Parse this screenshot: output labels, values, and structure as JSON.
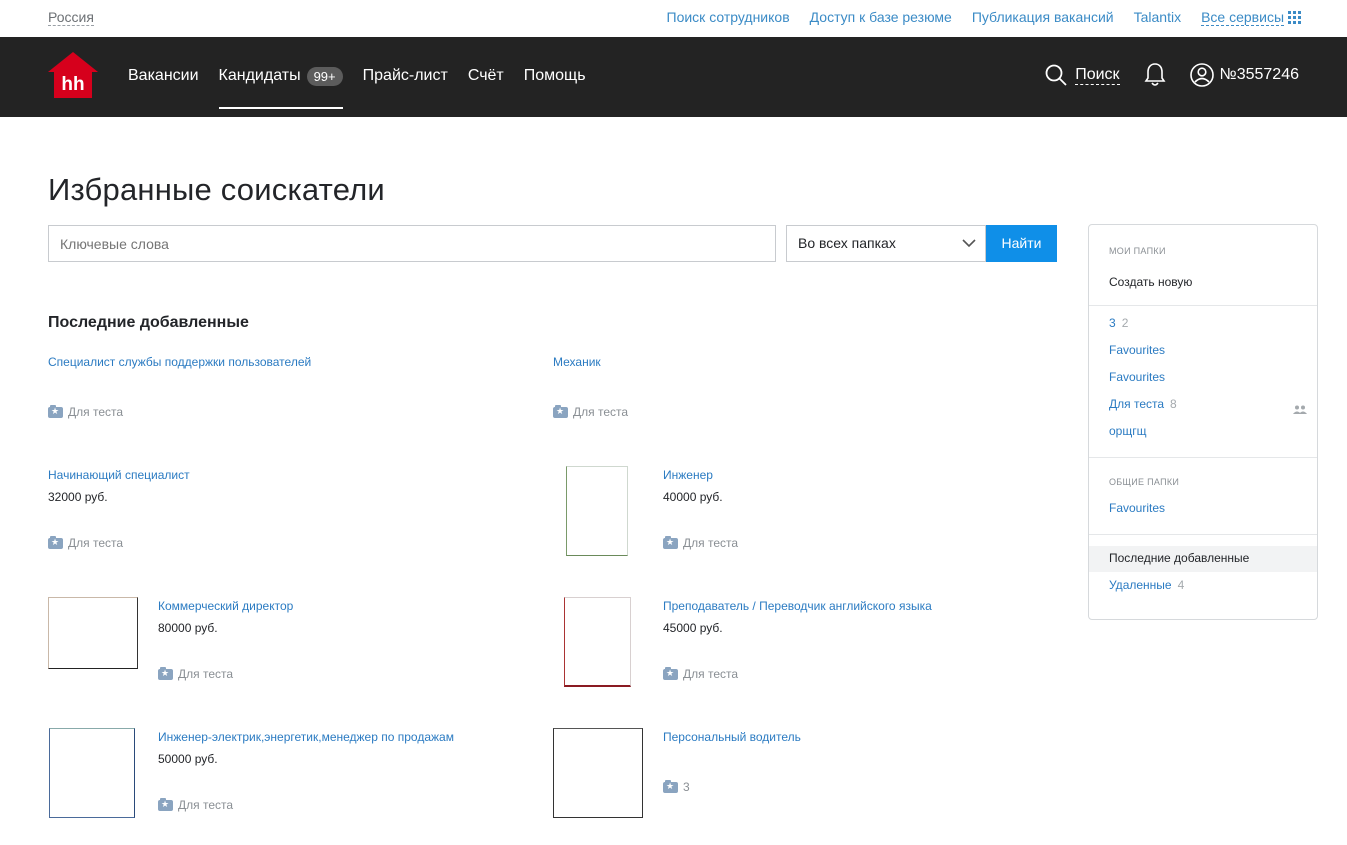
{
  "topbar": {
    "region": "Россия",
    "links": [
      "Поиск сотрудников",
      "Доступ к базе резюме",
      "Публикация вакансий",
      "Talantix"
    ],
    "all_services": "Все сервисы"
  },
  "nav": {
    "logo_text": "hh",
    "items": [
      "Вакансии",
      "Кандидаты",
      "Прайс-лист",
      "Счёт",
      "Помощь"
    ],
    "candidates_badge": "99+",
    "search_label": "Поиск",
    "account": "№3557246"
  },
  "main": {
    "title": "Избранные соискатели",
    "search_placeholder": "Ключевые слова",
    "folder_select": "Во всех папках",
    "find_button": "Найти",
    "section_title": "Последние добавленные",
    "cards": [
      {
        "title": "Специалист службы поддержки пользователей",
        "salary": "",
        "folder": "Для теста"
      },
      {
        "title": "Механик",
        "salary": "",
        "folder": "Для теста"
      },
      {
        "title": "Начинающий специалист",
        "salary": "32000 руб.",
        "folder": "Для теста"
      },
      {
        "title": "Инженер",
        "salary": "40000 руб.",
        "folder": "Для теста"
      },
      {
        "title": "Коммерческий директор",
        "salary": "80000 руб.",
        "folder": "Для теста"
      },
      {
        "title": "Преподаватель / Переводчик английского языка",
        "salary": "45000 руб.",
        "folder": "Для теста"
      },
      {
        "title": "Инженер-электрик,энергетик,менеджер по продажам",
        "salary": "50000 руб.",
        "folder": "Для теста"
      },
      {
        "title": "Персональный водитель",
        "salary": "",
        "folder": "3"
      }
    ]
  },
  "sidebar": {
    "my_folders_caption": "МОИ ПАПКИ",
    "create_new": "Создать новую",
    "my_folders": [
      {
        "name": "3",
        "count": "2"
      },
      {
        "name": "Favourites",
        "count": ""
      },
      {
        "name": "Favourites",
        "count": ""
      },
      {
        "name": "Для теста",
        "count": "8"
      },
      {
        "name": "орщгщ",
        "count": ""
      }
    ],
    "shared_caption": "ОБЩИЕ ПАПКИ",
    "shared_folders": [
      {
        "name": "Favourites"
      }
    ],
    "recent": "Последние добавленные",
    "deleted": {
      "name": "Удаленные",
      "count": "4"
    }
  },
  "colors": {
    "accent": "#0f8fe8",
    "link": "#2b7bc2",
    "nav_bg": "#232323",
    "logo_red": "#d6001c"
  }
}
